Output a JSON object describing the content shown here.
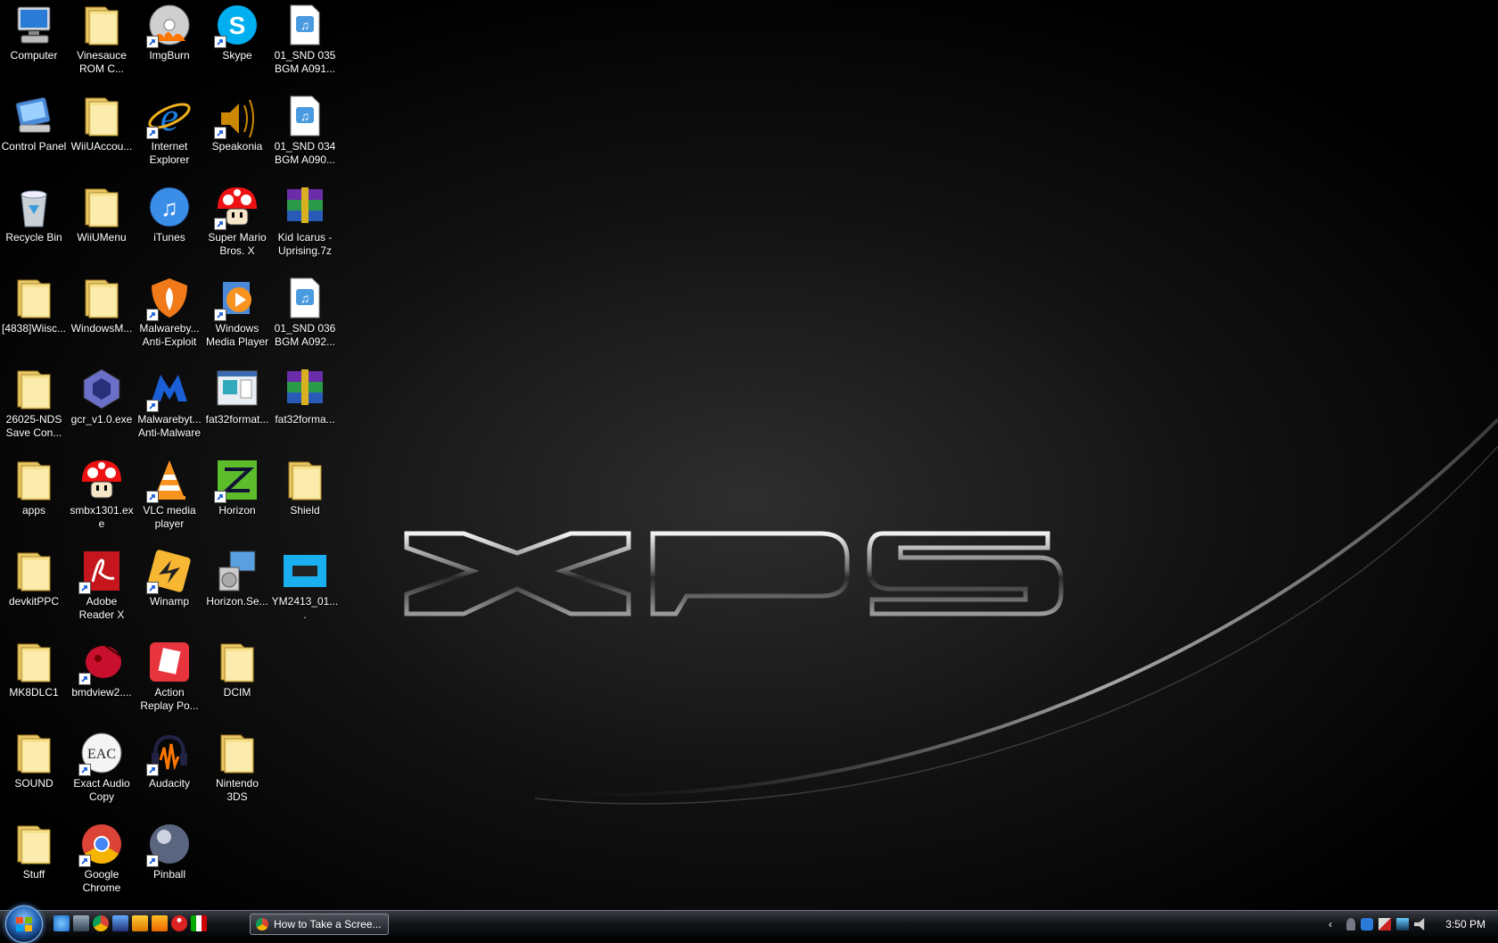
{
  "desktop": {
    "icons": [
      {
        "label": "Computer",
        "icon": "computer-icon",
        "kind": "computer",
        "shortcut": false
      },
      {
        "label": "Control Panel",
        "icon": "control-panel-icon",
        "kind": "cpanel",
        "shortcut": false
      },
      {
        "label": "Recycle Bin",
        "icon": "recycle-bin-icon",
        "kind": "bin",
        "shortcut": false
      },
      {
        "label": "[4838]Wiisc...",
        "icon": "folder-icon",
        "kind": "folder",
        "shortcut": false
      },
      {
        "label": "26025-NDS\nSave Con...",
        "icon": "folder-icon",
        "kind": "folder",
        "shortcut": false
      },
      {
        "label": "apps",
        "icon": "folder-icon",
        "kind": "folder",
        "shortcut": false
      },
      {
        "label": "devkitPPC",
        "icon": "folder-icon",
        "kind": "folder",
        "shortcut": false
      },
      {
        "label": "MK8DLC1",
        "icon": "folder-icon",
        "kind": "folder",
        "shortcut": false
      },
      {
        "label": "SOUND",
        "icon": "folder-icon",
        "kind": "folder",
        "shortcut": false
      },
      {
        "label": "Stuff",
        "icon": "folder-icon",
        "kind": "folder",
        "shortcut": false
      },
      {
        "label": "Vinesauce\nROM C...",
        "icon": "folder-icon",
        "kind": "folder",
        "shortcut": false
      },
      {
        "label": "WiiUAccou...",
        "icon": "folder-icon",
        "kind": "folder",
        "shortcut": false
      },
      {
        "label": "WiiUMenu",
        "icon": "folder-icon",
        "kind": "folder",
        "shortcut": false
      },
      {
        "label": "WindowsM...",
        "icon": "folder-icon",
        "kind": "folder",
        "shortcut": false
      },
      {
        "label": "gcr_v1.0.exe",
        "icon": "gamecube-icon",
        "kind": "gamecube",
        "shortcut": false
      },
      {
        "label": "smbx1301.exe",
        "icon": "mushroom-icon",
        "kind": "mushroom",
        "shortcut": false
      },
      {
        "label": "Adobe\nReader X",
        "icon": "adobe-reader-icon",
        "kind": "adobe",
        "shortcut": true
      },
      {
        "label": "bmdview2....",
        "icon": "bmdview-icon",
        "kind": "bmd",
        "shortcut": true
      },
      {
        "label": "Exact Audio\nCopy",
        "icon": "eac-icon",
        "kind": "eac",
        "shortcut": true
      },
      {
        "label": "Google\nChrome",
        "icon": "chrome-icon",
        "kind": "chrome",
        "shortcut": true
      },
      {
        "label": "ImgBurn",
        "icon": "imgburn-icon",
        "kind": "imgburn",
        "shortcut": true
      },
      {
        "label": "Internet\nExplorer",
        "icon": "internet-explorer-icon",
        "kind": "ie",
        "shortcut": true
      },
      {
        "label": "iTunes",
        "icon": "itunes-icon",
        "kind": "itunes",
        "shortcut": false
      },
      {
        "label": "Malwareby...\nAnti-Exploit",
        "icon": "malwarebytes-antiexploit-icon",
        "kind": "mbae",
        "shortcut": true
      },
      {
        "label": "Malwarebyt...\nAnti-Malware",
        "icon": "malwarebytes-icon",
        "kind": "mbam",
        "shortcut": true
      },
      {
        "label": "VLC media\nplayer",
        "icon": "vlc-icon",
        "kind": "vlc",
        "shortcut": true
      },
      {
        "label": "Winamp",
        "icon": "winamp-icon",
        "kind": "winamp",
        "shortcut": true
      },
      {
        "label": "Action\nReplay Po...",
        "icon": "action-replay-icon",
        "kind": "actionreplay",
        "shortcut": false
      },
      {
        "label": "Audacity",
        "icon": "audacity-icon",
        "kind": "audacity",
        "shortcut": true
      },
      {
        "label": "Pinball",
        "icon": "pinball-icon",
        "kind": "pinball",
        "shortcut": true
      },
      {
        "label": "Skype",
        "icon": "skype-icon",
        "kind": "skype",
        "shortcut": true
      },
      {
        "label": "Speakonia",
        "icon": "speakonia-icon",
        "kind": "speakonia",
        "shortcut": true
      },
      {
        "label": "Super Mario\nBros. X",
        "icon": "mushroom-icon",
        "kind": "mushroom",
        "shortcut": true
      },
      {
        "label": "Windows\nMedia Player",
        "icon": "windows-media-player-icon",
        "kind": "wmp",
        "shortcut": true
      },
      {
        "label": "fat32format...",
        "icon": "fat32format-icon",
        "kind": "fat32",
        "shortcut": false
      },
      {
        "label": "Horizon",
        "icon": "horizon-icon",
        "kind": "horizon",
        "shortcut": true
      },
      {
        "label": "Horizon.Se...",
        "icon": "horizon-setup-icon",
        "kind": "setup",
        "shortcut": false
      },
      {
        "label": "DCIM",
        "icon": "folder-icon",
        "kind": "folder",
        "shortcut": false
      },
      {
        "label": "Nintendo\n3DS",
        "icon": "folder-icon",
        "kind": "folder",
        "shortcut": false
      },
      {
        "label": "",
        "icon": "",
        "kind": "empty",
        "shortcut": false
      },
      {
        "label": "01_SND 035\nBGM A091...",
        "icon": "audio-file-icon",
        "kind": "audio",
        "shortcut": false
      },
      {
        "label": "01_SND 034\nBGM A090...",
        "icon": "audio-file-icon",
        "kind": "audio",
        "shortcut": false
      },
      {
        "label": "Kid Icarus -\nUprising.7z",
        "icon": "winrar-archive-icon",
        "kind": "rar",
        "shortcut": false
      },
      {
        "label": "01_SND 036\nBGM A092...",
        "icon": "audio-file-icon",
        "kind": "audio",
        "shortcut": false
      },
      {
        "label": "fat32forma...",
        "icon": "winrar-archive-icon",
        "kind": "rar",
        "shortcut": false
      },
      {
        "label": "Shield",
        "icon": "folder-icon",
        "kind": "folder",
        "shortcut": false
      },
      {
        "label": "YM2413_01....",
        "icon": "chip-image-icon",
        "kind": "chip",
        "shortcut": false
      },
      {
        "label": "",
        "icon": "",
        "kind": "empty",
        "shortcut": false
      },
      {
        "label": "",
        "icon": "",
        "kind": "empty",
        "shortcut": false
      },
      {
        "label": "",
        "icon": "",
        "kind": "empty",
        "shortcut": false
      }
    ]
  },
  "wallpaper": {
    "logo_text": "XPS",
    "colors": {
      "background": "#000000",
      "glow": "#2a2a2a",
      "swoosh": "#d8d8d8"
    }
  },
  "taskbar": {
    "start_icon": "windows-start-orb-icon",
    "quick_launch": [
      "internet-explorer-icon",
      "show-desktop-icon",
      "chrome-icon",
      "switch-windows-icon",
      "winamp-icon",
      "wmp-icon",
      "mushroom-icon",
      "flag-icon"
    ],
    "task_button_label": "How to Take a Scree...",
    "task_button_icon": "chrome-icon",
    "clock": "3:50 PM",
    "tray_icons": [
      "chevron-left-icon",
      "notification-icon",
      "malwarebytes-tray-icon",
      "volume-muted-icon",
      "network-icon",
      "speaker-icon"
    ]
  }
}
